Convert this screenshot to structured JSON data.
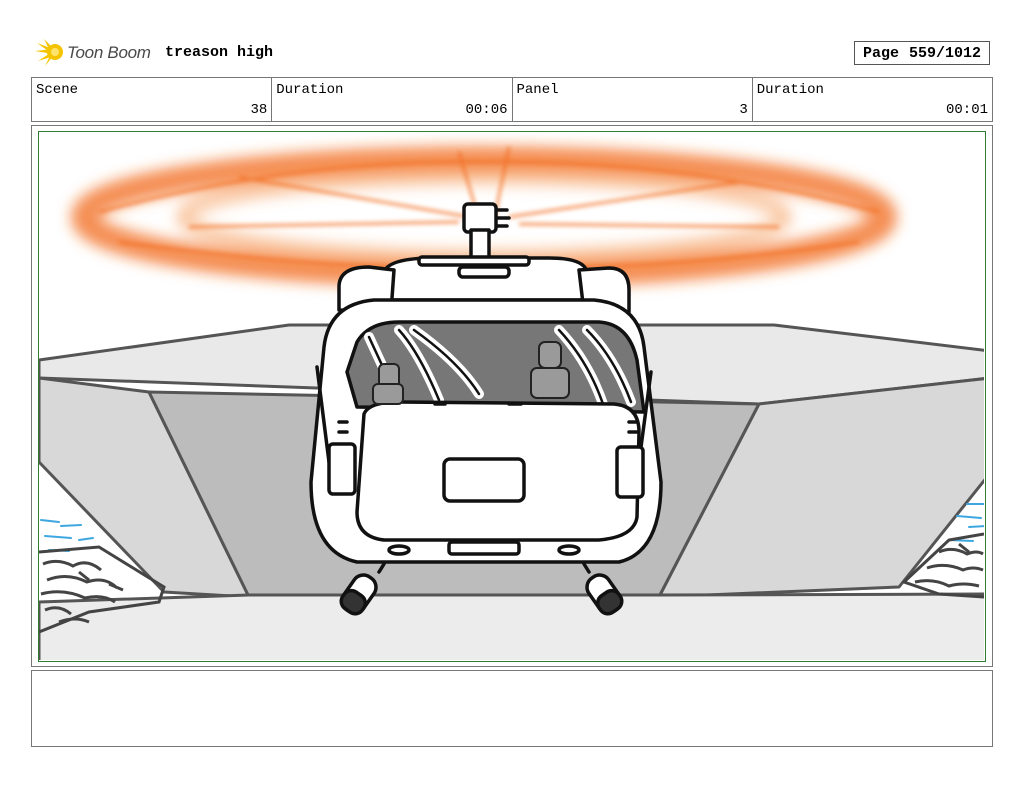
{
  "header": {
    "logo_text": "Toon Boom",
    "project_title": "treason high",
    "page_label": "Page",
    "page_number": "559/1012"
  },
  "info": {
    "scene_label": "Scene",
    "scene_value": "38",
    "duration_label": "Duration",
    "duration_value": "00:06",
    "panel_label": "Panel",
    "panel_value": "3",
    "panel_duration_label": "Duration",
    "panel_duration_value": "00:01"
  },
  "colors": {
    "rotor": "#f26a1b",
    "frame_border": "#2e7d32",
    "logo_star": "#f5c400"
  },
  "notes": ""
}
